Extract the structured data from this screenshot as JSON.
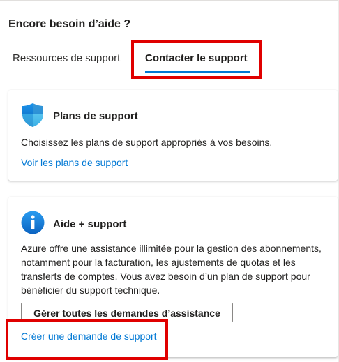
{
  "heading": "Encore besoin d’aide ?",
  "tabs": [
    {
      "label": "Ressources de support",
      "selected": false
    },
    {
      "label": "Contacter le support",
      "selected": true
    }
  ],
  "cards": {
    "plans": {
      "title": "Plans de support",
      "icon": "shield-icon",
      "description": "Choisissez les plans de support appropriés à vos besoins.",
      "link": "Voir les plans de support"
    },
    "help": {
      "title": "Aide + support",
      "icon": "info-icon",
      "description": "Azure offre une assistance illimitée pour la gestion des abonnements, notamment pour la facturation, les ajustements de quotas et les transferts de comptes. Vous avez besoin d’un plan de support pour bénéficier du support technique.",
      "button": "Gérer toutes les demandes d’assistance",
      "link": "Créer une demande de support"
    }
  },
  "colors": {
    "accent": "#0078d4",
    "highlight": "#e00000"
  }
}
